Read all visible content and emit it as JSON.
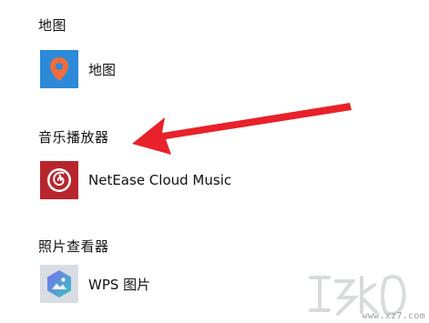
{
  "sections": [
    {
      "heading": "地图",
      "apps": [
        {
          "name": "地图",
          "icon": "maps-pin-icon",
          "tile_color": "#2c8ad8"
        }
      ]
    },
    {
      "heading": "音乐播放器",
      "apps": [
        {
          "name": "NetEase Cloud Music",
          "icon": "netease-music-icon",
          "tile_color": "#b8262d"
        }
      ]
    },
    {
      "heading": "照片查看器",
      "apps": [
        {
          "name": "WPS 图片",
          "icon": "wps-picture-icon",
          "tile_color": "#d9dde3"
        }
      ]
    }
  ],
  "annotation": {
    "arrow_color": "#e8212a"
  },
  "watermark": {
    "text": "www.xz7.com"
  }
}
